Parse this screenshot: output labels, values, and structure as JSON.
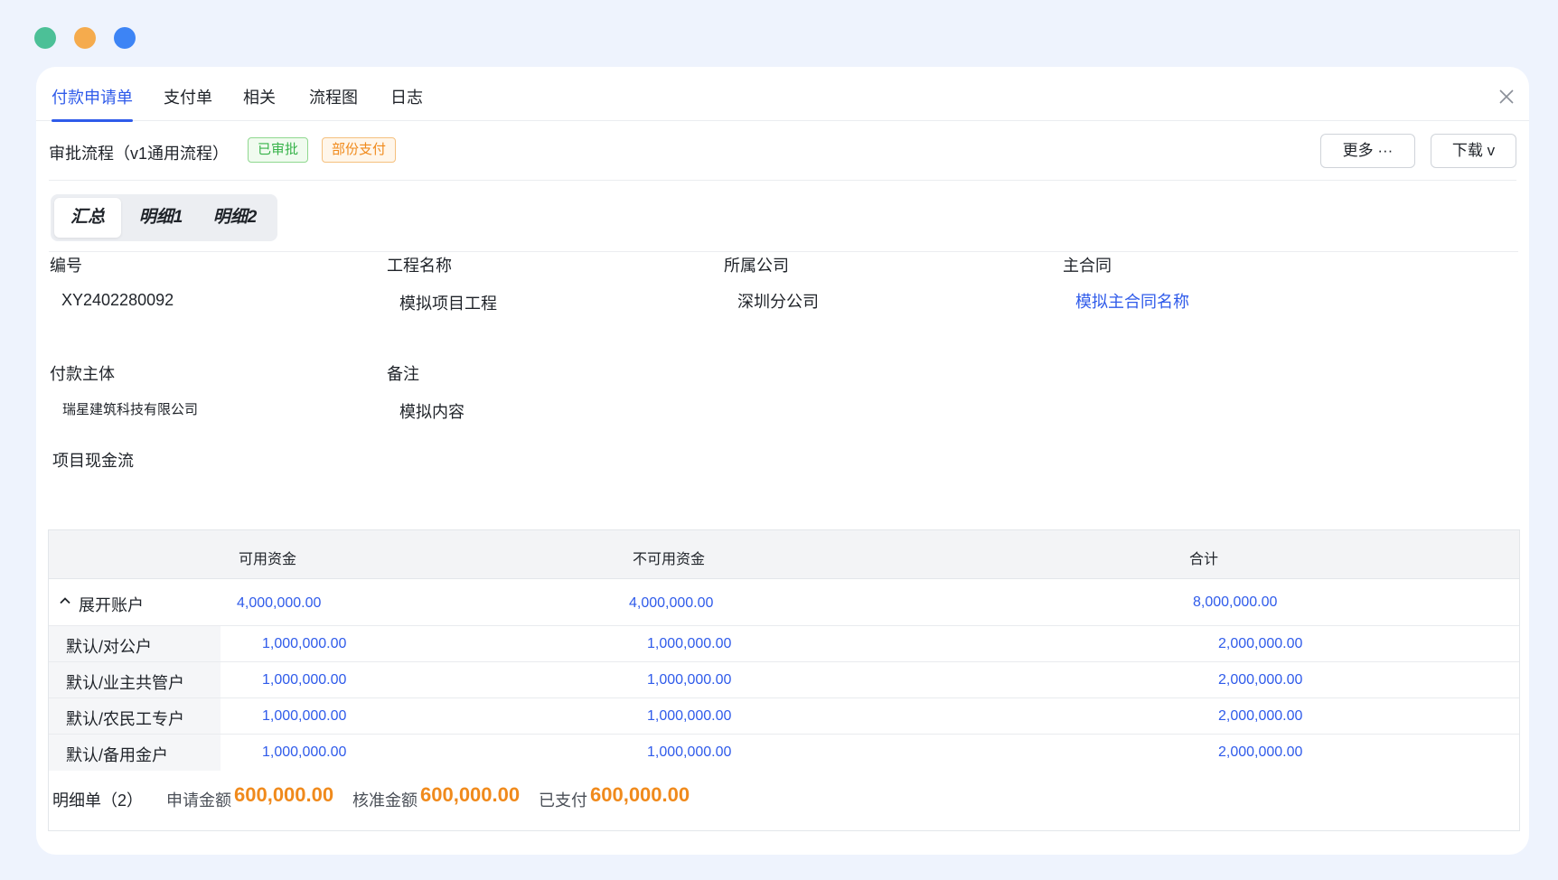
{
  "window_dots": [
    "close",
    "minimize",
    "maximize"
  ],
  "tabs": [
    {
      "label": "付款申请单"
    },
    {
      "label": "支付单"
    },
    {
      "label": "相关"
    },
    {
      "label": "流程图"
    },
    {
      "label": "日志"
    }
  ],
  "approval": {
    "title": "审批流程（v1通用流程）",
    "tags": [
      "已审批",
      "部份支付"
    ],
    "more_label": "更多 ···",
    "download_label": "下载 v"
  },
  "segments": [
    "汇总",
    "明细1",
    "明细2"
  ],
  "fields": {
    "number": {
      "label": "编号",
      "value": "XY2402280092"
    },
    "project": {
      "label": "工程名称",
      "value": "模拟项目工程"
    },
    "company": {
      "label": "所属公司",
      "value": "深圳分公司"
    },
    "contract": {
      "label": "主合同",
      "value": "模拟主合同名称"
    },
    "payer": {
      "label": "付款主体",
      "value": "瑞星建筑科技有限公司"
    },
    "remark": {
      "label": "备注",
      "value": "模拟内容"
    }
  },
  "cashflow": {
    "title": "项目现金流",
    "headers": [
      "可用资金",
      "不可用资金",
      "合计"
    ],
    "group": {
      "label": "展开账户",
      "available": "4,000,000.00",
      "unavailable": "4,000,000.00",
      "total": "8,000,000.00"
    },
    "rows": [
      {
        "name": "默认/对公户",
        "available": "1,000,000.00",
        "unavailable": "1,000,000.00",
        "total": "2,000,000.00"
      },
      {
        "name": "默认/业主共管户",
        "available": "1,000,000.00",
        "unavailable": "1,000,000.00",
        "total": "2,000,000.00"
      },
      {
        "name": "默认/农民工专户",
        "available": "1,000,000.00",
        "unavailable": "1,000,000.00",
        "total": "2,000,000.00"
      },
      {
        "name": "默认/备用金户",
        "available": "1,000,000.00",
        "unavailable": "1,000,000.00",
        "total": "2,000,000.00"
      }
    ]
  },
  "footer": {
    "title": "明细单（2）",
    "apply_label": "申请金额",
    "apply_amount": "600,000.00",
    "approved_label": "核准金额",
    "approved_amount": "600,000.00",
    "paid_label": "已支付",
    "paid_amount": "600,000.00"
  },
  "colors": {
    "accent": "#2f5bea",
    "amount": "#f08a1c",
    "tag_approved": "#37b34a",
    "tag_partial": "#f08a1c"
  }
}
